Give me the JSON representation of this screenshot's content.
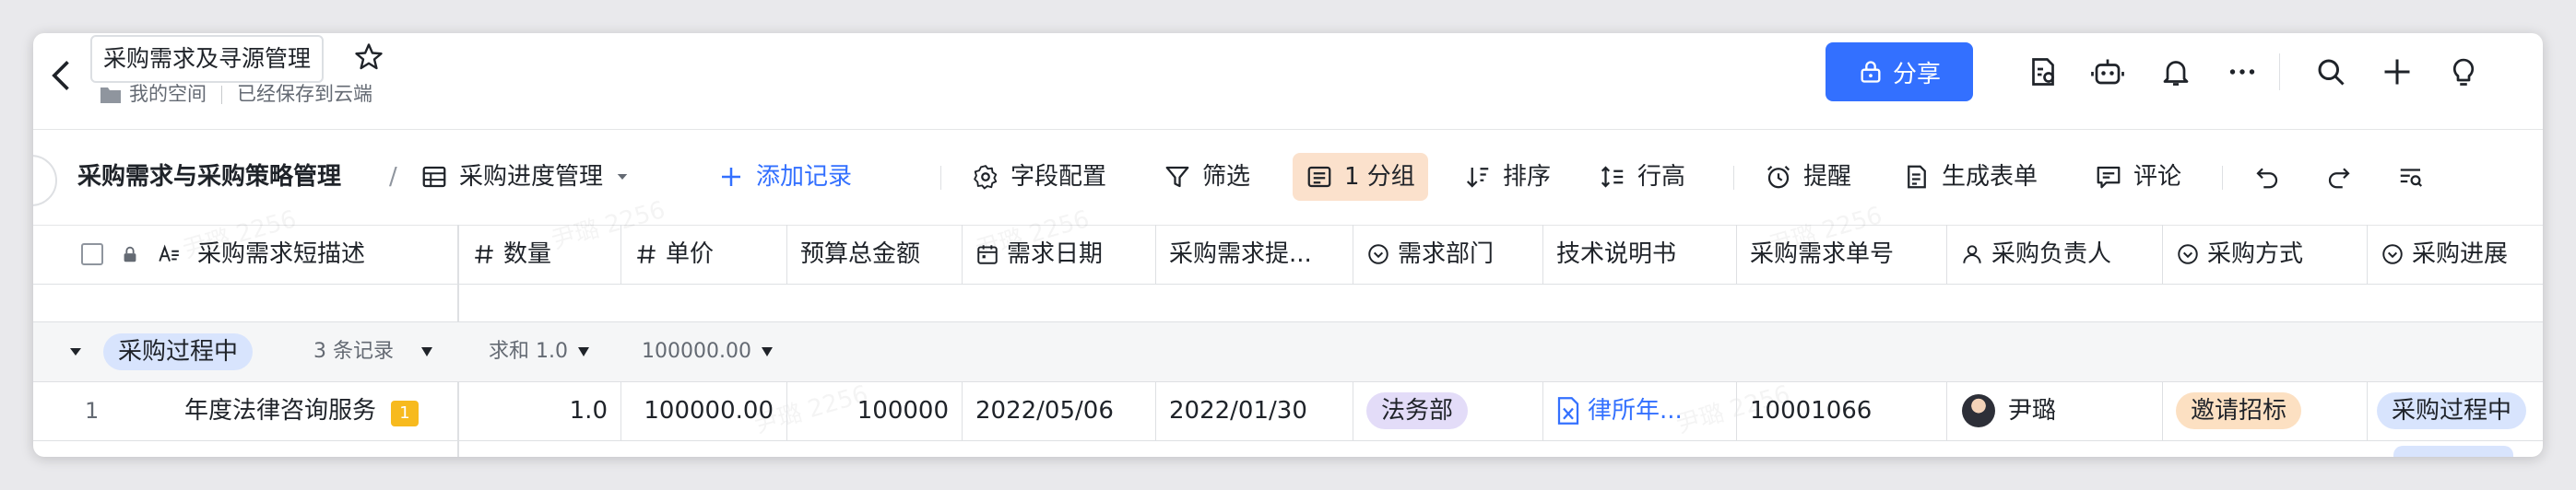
{
  "titlebar": {
    "doc_title": "采购需求及寻源管理",
    "breadcrumb_space": "我的空间",
    "save_status": "已经保存到云端",
    "share_label": "分享"
  },
  "toolbar": {
    "base_name": "采购需求与采购策略管理",
    "view_name": "采购进度管理",
    "add_record": "添加记录",
    "field_config": "字段配置",
    "filter": "筛选",
    "group": "1 分组",
    "sort": "排序",
    "row_height": "行高",
    "reminder": "提醒",
    "generate_form": "生成表单",
    "comment": "评论"
  },
  "grid": {
    "columns": [
      {
        "label": "采购需求短描述",
        "icon": "text-icon"
      },
      {
        "label": "数量",
        "icon": "number-icon"
      },
      {
        "label": "单价",
        "icon": "number-icon"
      },
      {
        "label": "预算总金额",
        "icon": ""
      },
      {
        "label": "需求日期",
        "icon": "calendar-icon"
      },
      {
        "label": "采购需求提...",
        "icon": ""
      },
      {
        "label": "需求部门",
        "icon": "select-icon"
      },
      {
        "label": "技术说明书",
        "icon": ""
      },
      {
        "label": "采购需求单号",
        "icon": ""
      },
      {
        "label": "采购负责人",
        "icon": "person-icon"
      },
      {
        "label": "采购方式",
        "icon": "select-icon"
      },
      {
        "label": "采购进展",
        "icon": "select-icon"
      }
    ],
    "group": {
      "label": "采购过程中",
      "count": "3 条记录",
      "sum_label": "求和 1.0",
      "sum_value": "100000.00"
    },
    "rows": [
      {
        "index": "1",
        "badge": "1",
        "description": "年度法律咨询服务",
        "quantity": "1.0",
        "unit_price": "100000.00",
        "budget_total": "100000",
        "need_date": "2022/05/06",
        "submit_date": "2022/01/30",
        "department": "法务部",
        "spec": "律所年...",
        "order_no": "10001066",
        "owner": "尹璐",
        "method": "邀请招标",
        "progress": "采购过程中"
      }
    ]
  },
  "colors": {
    "accent": "#3370ff",
    "group_tag": "#d8e4fd",
    "dept_tag": "#e3dcf8",
    "method_tag": "#fce0c2",
    "active_tool": "#fbe1cc"
  }
}
